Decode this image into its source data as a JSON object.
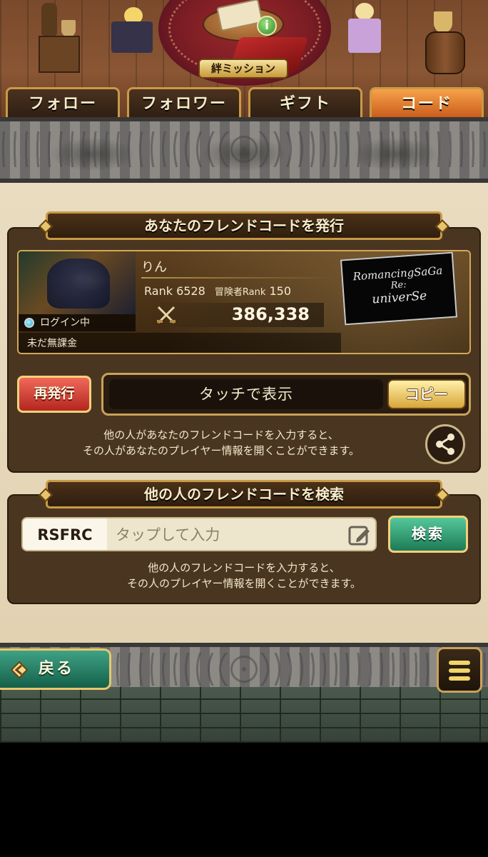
{
  "scene": {
    "mission_label": "絆ミッション",
    "info_badge": "i"
  },
  "tabs": [
    {
      "label": "フォロー",
      "active": false
    },
    {
      "label": "フォロワー",
      "active": false
    },
    {
      "label": "ギフト",
      "active": false
    },
    {
      "label": "コード",
      "active": true
    }
  ],
  "issue_section": {
    "title": "あなたのフレンドコードを発行",
    "player": {
      "name": "りん",
      "rank_label": "Rank",
      "rank": "6528",
      "adventurer_rank_label": "冒険者Rank",
      "adventurer_rank": "150",
      "power": "386,338",
      "login_status": "ログイン中",
      "spend_status": "未だ無課金"
    },
    "logo": {
      "line1": "RomancingSaGa",
      "line2": "Re:",
      "line3": "univerSe"
    },
    "reissue_label": "再発行",
    "code_display": "タッチで表示",
    "copy_label": "コピー",
    "description_line1": "他の人があなたのフレンドコードを入力すると、",
    "description_line2": "その人があなたのプレイヤー情報を開くことができます。"
  },
  "search_section": {
    "title": "他の人のフレンドコードを検索",
    "prefix": "RSFRC",
    "placeholder": "タップして入力",
    "value": "",
    "search_label": "検索",
    "description_line1": "他の人のフレンドコードを入力すると、",
    "description_line2": "その人のプレイヤー情報を開くことができます。"
  },
  "footer": {
    "back_label": "戻る"
  },
  "colors": {
    "active_tab": "#e07a2e",
    "tab_border": "#c99a45",
    "reissue": "#d8392f",
    "copy": "#e9c25a",
    "search": "#2f9a72",
    "back": "#2a8468"
  }
}
